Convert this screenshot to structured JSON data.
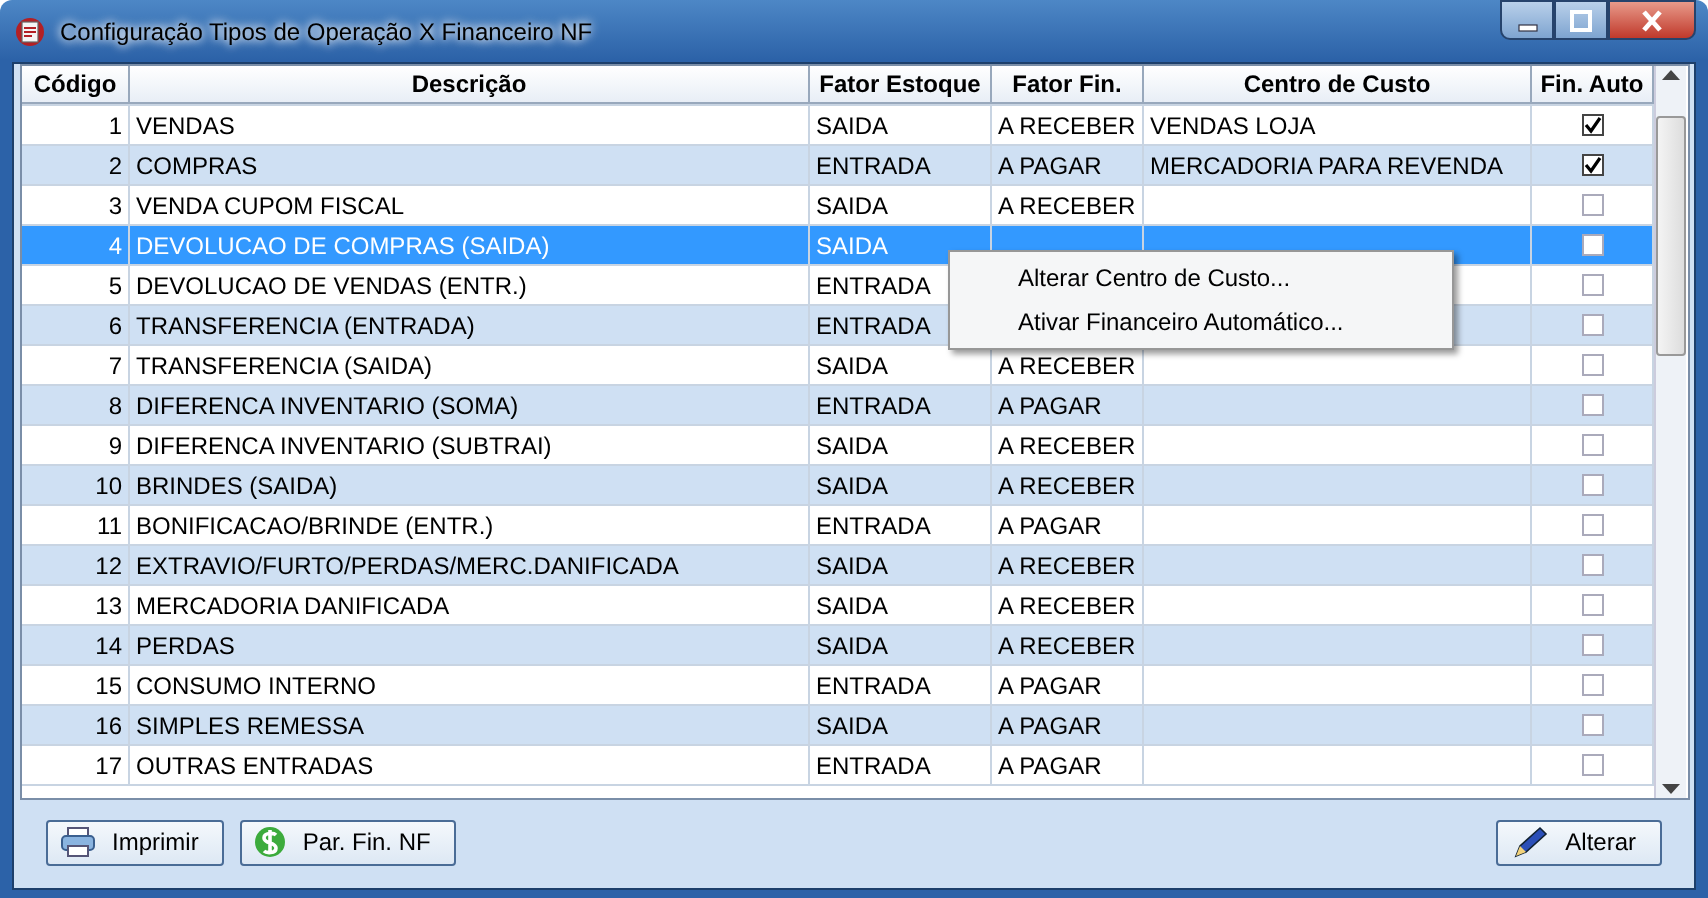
{
  "window": {
    "title": "Configuração Tipos de Operação X Financeiro NF"
  },
  "table": {
    "columns": [
      "Código",
      "Descrição",
      "Fator Estoque",
      "Fator Fin.",
      "Centro de Custo",
      "Fin. Auto"
    ],
    "rows": [
      {
        "code": "1",
        "description": "VENDAS",
        "stock_factor": "SAIDA",
        "fin_factor": "A RECEBER",
        "cost_center": "VENDAS LOJA",
        "fin_auto": true,
        "selected": false
      },
      {
        "code": "2",
        "description": "COMPRAS",
        "stock_factor": "ENTRADA",
        "fin_factor": "A PAGAR",
        "cost_center": "MERCADORIA PARA REVENDA",
        "fin_auto": true,
        "selected": false
      },
      {
        "code": "3",
        "description": "VENDA CUPOM FISCAL",
        "stock_factor": "SAIDA",
        "fin_factor": "A RECEBER",
        "fin_auto": false,
        "selected": false
      },
      {
        "code": "4",
        "description": "DEVOLUCAO DE COMPRAS (SAIDA)",
        "stock_factor": "SAIDA",
        "fin_auto": false,
        "selected": true
      },
      {
        "code": "5",
        "description": "DEVOLUCAO DE VENDAS (ENTR.)",
        "stock_factor": "ENTRADA",
        "fin_auto": false,
        "selected": false
      },
      {
        "code": "6",
        "description": "TRANSFERENCIA (ENTRADA)",
        "stock_factor": "ENTRADA",
        "fin_auto": false,
        "selected": false
      },
      {
        "code": "7",
        "description": "TRANSFERENCIA (SAIDA)",
        "stock_factor": "SAIDA",
        "fin_factor": "A RECEBER",
        "fin_auto": false,
        "selected": false
      },
      {
        "code": "8",
        "description": "DIFERENCA INVENTARIO (SOMA)",
        "stock_factor": "ENTRADA",
        "fin_factor": "A PAGAR",
        "fin_auto": false,
        "selected": false
      },
      {
        "code": "9",
        "description": "DIFERENCA INVENTARIO (SUBTRAI)",
        "stock_factor": "SAIDA",
        "fin_factor": "A RECEBER",
        "fin_auto": false,
        "selected": false
      },
      {
        "code": "10",
        "description": "BRINDES (SAIDA)",
        "stock_factor": "SAIDA",
        "fin_factor": "A RECEBER",
        "fin_auto": false,
        "selected": false
      },
      {
        "code": "11",
        "description": "BONIFICACAO/BRINDE (ENTR.)",
        "stock_factor": "ENTRADA",
        "fin_factor": "A PAGAR",
        "fin_auto": false,
        "selected": false
      },
      {
        "code": "12",
        "description": "EXTRAVIO/FURTO/PERDAS/MERC.DANIFICADA",
        "stock_factor": "SAIDA",
        "fin_factor": "A RECEBER",
        "fin_auto": false,
        "selected": false
      },
      {
        "code": "13",
        "description": "MERCADORIA DANIFICADA",
        "stock_factor": "SAIDA",
        "fin_factor": "A RECEBER",
        "fin_auto": false,
        "selected": false
      },
      {
        "code": "14",
        "description": "PERDAS",
        "stock_factor": "SAIDA",
        "fin_factor": "A RECEBER",
        "fin_auto": false,
        "selected": false
      },
      {
        "code": "15",
        "description": "CONSUMO INTERNO",
        "stock_factor": "ENTRADA",
        "fin_factor": "A PAGAR",
        "fin_auto": false,
        "selected": false
      },
      {
        "code": "16",
        "description": "SIMPLES REMESSA",
        "stock_factor": "SAIDA",
        "fin_factor": "A PAGAR",
        "fin_auto": false,
        "selected": false
      },
      {
        "code": "17",
        "description": "OUTRAS ENTRADAS",
        "stock_factor": "ENTRADA",
        "fin_factor": "A PAGAR",
        "fin_auto": false,
        "selected": false
      }
    ]
  },
  "context_menu": {
    "items": [
      "Alterar Centro de Custo...",
      "Ativar Financeiro Automático..."
    ]
  },
  "buttons": [
    {
      "label": "Imprimir",
      "kind": "print"
    },
    {
      "label": "Par. Fin. NF",
      "kind": "money"
    },
    {
      "label": "Alterar",
      "kind": "edit"
    }
  ]
}
